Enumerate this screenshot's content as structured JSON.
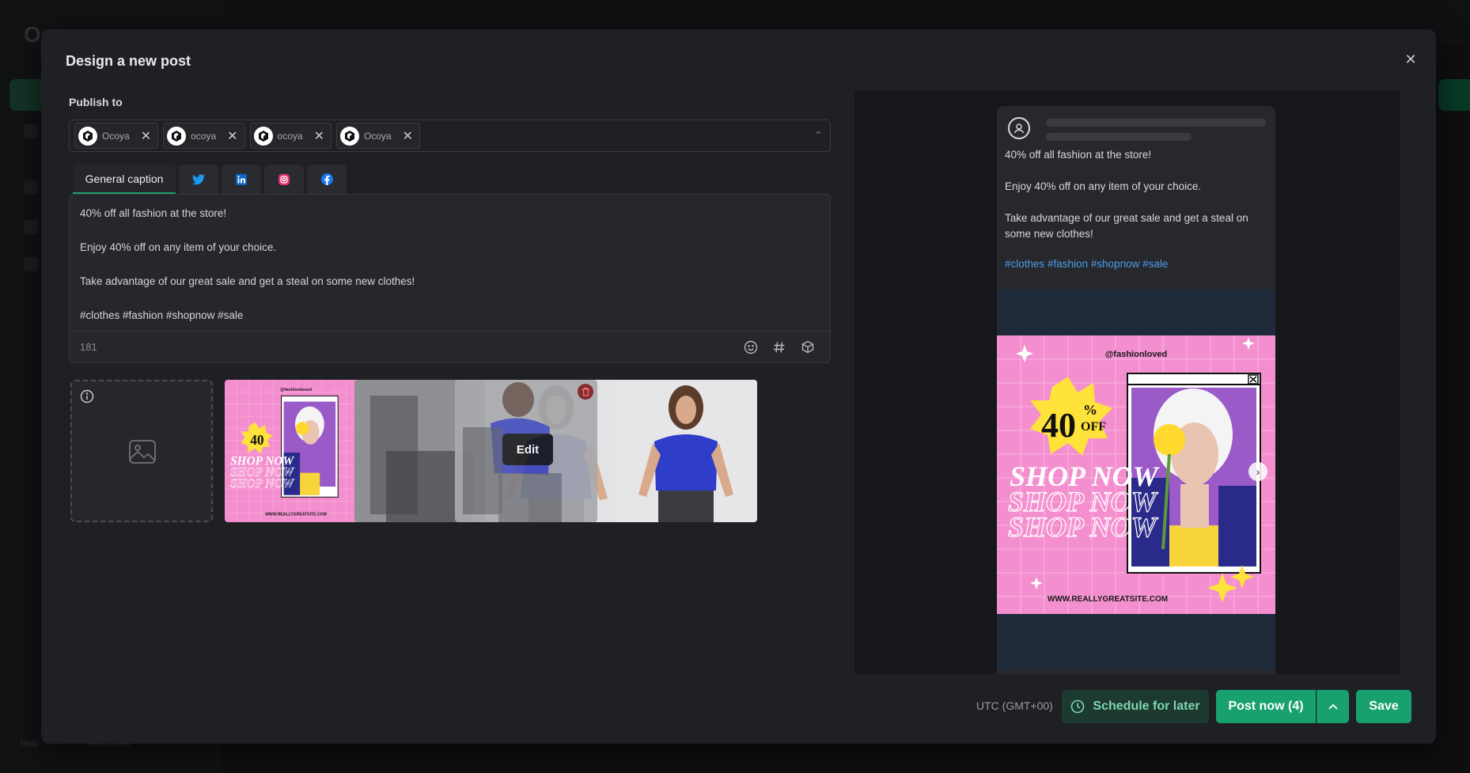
{
  "background": {
    "logo": "Ocoya",
    "help": "Help",
    "whats_new": "What's new"
  },
  "modal": {
    "title": "Design a new post",
    "close_icon": "close-icon"
  },
  "publish": {
    "label": "Publish to",
    "accounts": [
      {
        "name": "Ocoya",
        "network": "twitter"
      },
      {
        "name": "ocoya",
        "network": "linkedin"
      },
      {
        "name": "ocoya",
        "network": "instagram"
      },
      {
        "name": "Ocoya",
        "network": "facebook"
      }
    ]
  },
  "tabs": {
    "general": "General caption",
    "icons": [
      "twitter-icon",
      "linkedin-icon",
      "instagram-icon",
      "facebook-icon"
    ],
    "colors": {
      "twitter": "#1d9bf0",
      "linkedin": "#0a66c2",
      "instagram": "#e1306c",
      "facebook": "#1877f2"
    }
  },
  "caption": {
    "text": "40% off all fashion at the store!\n\nEnjoy 40% off on any item of your choice.\n\nTake advantage of our great sale and get a steal on some new clothes!\n\n#clothes #fashion #shopnow #sale",
    "char_count": "181"
  },
  "media": {
    "edit_label": "Edit",
    "ad": {
      "handle": "@fashionloved",
      "discount": "40",
      "percent": "%",
      "off": "OFF",
      "shop": "SHOP NOW",
      "site": "WWW.REALLYGREATSITE.COM"
    }
  },
  "preview": {
    "text": "40% off all fashion at the store!\n\nEnjoy 40% off on any item of your choice.\n\nTake advantage of our great sale and get a steal on some new clothes!",
    "tags": "#clothes #fashion #shopnow #sale"
  },
  "footer": {
    "timezone": "UTC (GMT+00)",
    "schedule": "Schedule for later",
    "post_now": "Post now (4)",
    "save": "Save"
  },
  "colors": {
    "accent": "#18a06f",
    "link": "#4f9bea",
    "ad_pink": "#f48fcf",
    "ad_yellow": "#ffe23a"
  }
}
